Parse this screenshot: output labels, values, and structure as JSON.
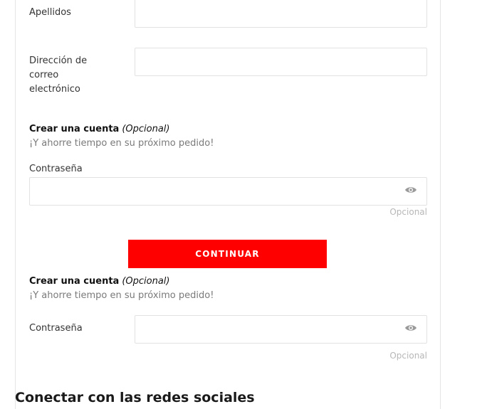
{
  "form": {
    "last_name": {
      "label": "Apellidos",
      "value": ""
    },
    "email": {
      "label": "Dirección de correo electrónico",
      "value": ""
    },
    "create_account_1": {
      "title": "Crear una cuenta",
      "optional": "(Opcional)",
      "subtitle": "¡Y ahorre tiempo en su próximo pedido!",
      "password_label": "Contraseña",
      "password_value": "",
      "hint": "Opcional",
      "icon": "eye-icon"
    },
    "continue_label": "Continuar",
    "create_account_2": {
      "title": "Crear una cuenta",
      "optional": "(Opcional)",
      "subtitle": "¡Y ahorre tiempo en su próximo pedido!",
      "password_label": "Contraseña",
      "password_value": "",
      "hint": "Opcional",
      "icon": "eye-icon"
    }
  },
  "social": {
    "heading": "Conectar con las redes sociales"
  },
  "colors": {
    "accent": "#ff0000",
    "border": "#e2e2e2",
    "muted": "#b7b7b7"
  }
}
